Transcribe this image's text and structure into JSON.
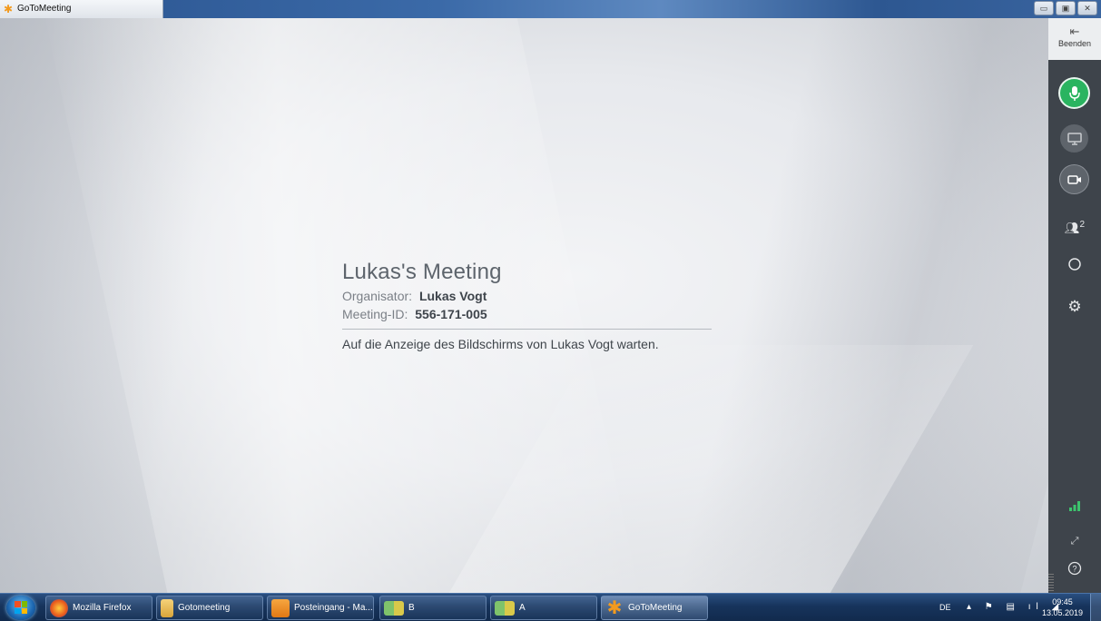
{
  "window": {
    "title": "GoToMeeting",
    "controls": [
      "minimize",
      "maximize",
      "close"
    ]
  },
  "meeting": {
    "title": "Lukas's Meeting",
    "organizer_label": "Organisator:",
    "organizer_name": "Lukas Vogt",
    "meeting_id_label": "Meeting-ID:",
    "meeting_id": "556-171-005",
    "waiting_message": "Auf die Anzeige des Bildschirms von Lukas Vogt warten."
  },
  "sidebar": {
    "end_label": "Beenden",
    "participants_count": "2",
    "mic_state": "on",
    "accent_color": "#2ab460"
  },
  "taskbar": {
    "items": [
      {
        "label": "Mozilla Firefox",
        "icon": "firefox-icon"
      },
      {
        "label": "Gotomeeting",
        "icon": "folder-icon"
      },
      {
        "label": "Posteingang - Ma...",
        "icon": "outlook-icon"
      },
      {
        "label": "B",
        "icon": "network-app-icon"
      },
      {
        "label": "A",
        "icon": "network-app-icon"
      },
      {
        "label": "GoToMeeting",
        "icon": "gotomeeting-icon"
      }
    ],
    "language": "DE",
    "time": "09:45",
    "date": "13.05.2019"
  }
}
